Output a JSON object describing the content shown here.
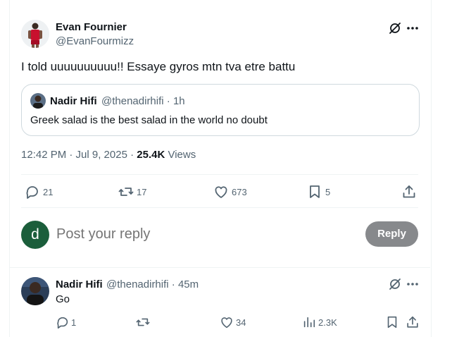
{
  "main_post": {
    "author_name": "Evan Fournier",
    "author_handle": "@EvanFourmizz",
    "text": "I told uuuuuuuuuu!! Essaye gyros mtn tva etre battu",
    "quote": {
      "author_name": "Nadir Hifi",
      "author_handle": "@thenadirhifi",
      "separator": "·",
      "time": "1h",
      "text": "Greek salad is the best salad in the world no doubt"
    },
    "timestamp": "12:42 PM · Jul 9, 2025 · ",
    "views_count": "25.4K",
    "views_label": " Views",
    "actions": {
      "replies": "21",
      "reposts": "17",
      "likes": "673",
      "bookmarks": "5"
    }
  },
  "reply_composer": {
    "avatar_letter": "d",
    "avatar_color": "#1b5e3b",
    "placeholder": "Post your reply",
    "button_label": "Reply"
  },
  "reply": {
    "author_name": "Nadir Hifi",
    "author_handle": "@thenadirhifi",
    "separator": "·",
    "time": "45m",
    "text": "Go",
    "actions": {
      "replies": "1",
      "likes": "34",
      "views": "2.3K"
    }
  },
  "icons": [
    "grok-icon",
    "more-icon",
    "reply-icon",
    "repost-icon",
    "like-icon",
    "bookmark-icon",
    "share-icon",
    "views-icon"
  ],
  "colors": {
    "text": "#0f1419",
    "secondary": "#536471",
    "border": "#cfd9de",
    "reply_button_bg": "#87898c"
  }
}
